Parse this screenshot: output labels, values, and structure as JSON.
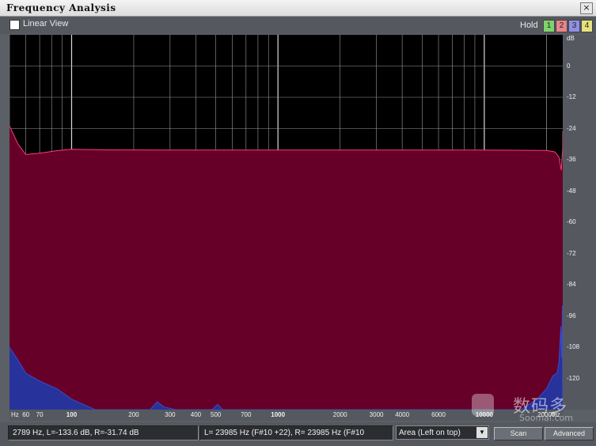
{
  "window": {
    "title": "Frequency Analysis",
    "close_label": "×"
  },
  "toolbar": {
    "linear_view_label": "Linear View",
    "linear_view_checked": false,
    "hold_label": "Hold",
    "hold_buttons": [
      {
        "label": "1",
        "color": "#7ed46b"
      },
      {
        "label": "2",
        "color": "#e8858a"
      },
      {
        "label": "3",
        "color": "#8f8fe8"
      },
      {
        "label": "4",
        "color": "#e8e27e"
      }
    ]
  },
  "chart_data": {
    "type": "area",
    "xscale": "log",
    "xlim": [
      50,
      24000
    ],
    "ylim": [
      -132,
      12
    ],
    "y_unit_label": "dB",
    "x_unit_label": "Hz",
    "y_ticks": [
      0,
      -12,
      -24,
      -36,
      -48,
      -60,
      -72,
      -84,
      -96,
      -108,
      -120
    ],
    "x_ticks": [
      60,
      70,
      100,
      200,
      300,
      400,
      500,
      700,
      1000,
      2000,
      3000,
      4000,
      6000,
      10000,
      20000
    ],
    "x_tick_labels": [
      "60",
      "70",
      "100",
      "200",
      "300",
      "400",
      "500",
      "700",
      "1000",
      "2000",
      "3000",
      "4000",
      "6000",
      "10000",
      "20000"
    ],
    "major_x_ticks": [
      100,
      1000,
      10000
    ],
    "series": [
      {
        "channel": "R",
        "color": "#660028",
        "line_color": "#ff3c78",
        "points": [
          [
            50,
            -23
          ],
          [
            55,
            -30
          ],
          [
            60,
            -34
          ],
          [
            70,
            -33.5
          ],
          [
            85,
            -32.5
          ],
          [
            100,
            -32
          ],
          [
            150,
            -32.2
          ],
          [
            300,
            -32.3
          ],
          [
            1000,
            -32.3
          ],
          [
            5000,
            -32.3
          ],
          [
            10000,
            -32.3
          ],
          [
            20000,
            -32.4
          ],
          [
            22000,
            -33
          ],
          [
            23000,
            -35
          ],
          [
            23600,
            -40
          ],
          [
            23985,
            -31.7
          ],
          [
            24000,
            -25
          ]
        ]
      },
      {
        "channel": "L",
        "color": "#27339a",
        "line_color": "#3a4bd0",
        "points": [
          [
            50,
            -108
          ],
          [
            55,
            -113
          ],
          [
            60,
            -118
          ],
          [
            70,
            -121
          ],
          [
            85,
            -124
          ],
          [
            100,
            -128
          ],
          [
            130,
            -132
          ],
          [
            240,
            -132
          ],
          [
            260,
            -129
          ],
          [
            280,
            -131
          ],
          [
            320,
            -132
          ],
          [
            480,
            -132
          ],
          [
            510,
            -130
          ],
          [
            540,
            -132
          ],
          [
            15000,
            -132
          ],
          [
            18000,
            -128
          ],
          [
            20000,
            -124
          ],
          [
            21500,
            -119
          ],
          [
            22500,
            -118
          ],
          [
            23000,
            -114
          ],
          [
            23500,
            -100
          ],
          [
            23700,
            -112
          ],
          [
            23900,
            -92
          ],
          [
            23985,
            -133.6
          ],
          [
            24000,
            -132
          ]
        ]
      }
    ]
  },
  "status": {
    "cursor_readout": "2789 Hz, L=-133.6 dB, R=-31.74 dB",
    "peak_readout": "L=  23985 Hz (F#10 +22), R=  23985 Hz (F#10",
    "display_mode": "Area (Left on top)",
    "scan_label": "Scan",
    "advanced_label": "Advanced"
  },
  "watermark": {
    "cn_text": "数码多",
    "en_text": "Soomal.com"
  }
}
